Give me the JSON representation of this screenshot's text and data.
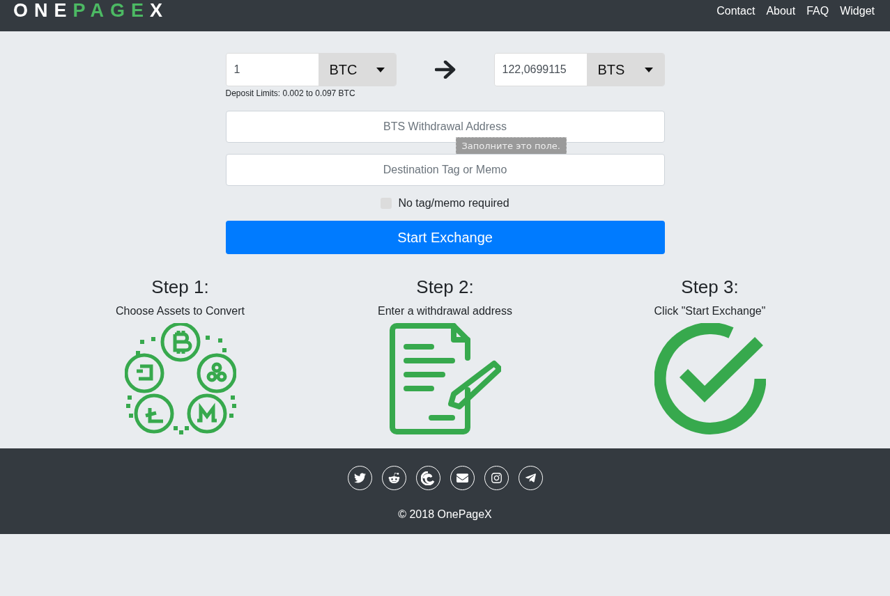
{
  "navbar": {
    "logo": [
      {
        "text": "ONE",
        "highlight": false
      },
      {
        "text": "PAGE",
        "highlight": true
      },
      {
        "text": "X",
        "highlight": false
      }
    ],
    "links": [
      "Contact",
      "About",
      "FAQ",
      "Widget"
    ]
  },
  "exchange": {
    "from": {
      "amount": "1",
      "currency": "BTC"
    },
    "to": {
      "amount": "122,0699115",
      "currency": "BTS"
    },
    "deposit_limits": "Deposit Limits: 0.002 to 0.097 BTC",
    "address_field": {
      "placeholder": "BTS Withdrawal Address"
    },
    "tooltip": "Заполните это поле.",
    "memo_field": {
      "placeholder": "Destination Tag or Memo"
    },
    "no_memo": {
      "label": "No tag/memo required",
      "checked": false
    },
    "submit": "Start Exchange"
  },
  "steps": [
    {
      "title": "Step 1:",
      "text": "Choose Assets to Convert",
      "kind": "coins"
    },
    {
      "title": "Step 2:",
      "text": "Enter a withdrawal address",
      "kind": "document"
    },
    {
      "title": "Step 3:",
      "text": "Click \"Start Exchange\"",
      "kind": "check"
    }
  ],
  "footer": {
    "social": [
      {
        "kind": "twitter"
      },
      {
        "kind": "reddit"
      },
      {
        "kind": "swirl"
      },
      {
        "kind": "mail"
      },
      {
        "kind": "instagram"
      },
      {
        "kind": "telegram"
      }
    ],
    "copyright": "© 2018 OnePageX"
  }
}
